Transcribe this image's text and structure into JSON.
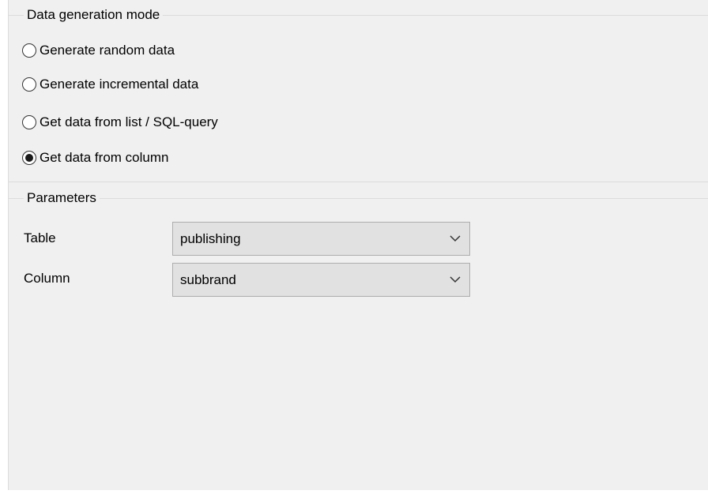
{
  "mode_group": {
    "title": "Data generation mode",
    "options": [
      {
        "label": "Generate random data",
        "selected": false
      },
      {
        "label": "Generate incremental data",
        "selected": false
      },
      {
        "label": "Get data from list / SQL-query",
        "selected": false
      },
      {
        "label": "Get data from column",
        "selected": true
      }
    ]
  },
  "params_group": {
    "title": "Parameters",
    "table": {
      "label": "Table",
      "value": "publishing"
    },
    "column": {
      "label": "Column",
      "value": "subbrand"
    }
  }
}
